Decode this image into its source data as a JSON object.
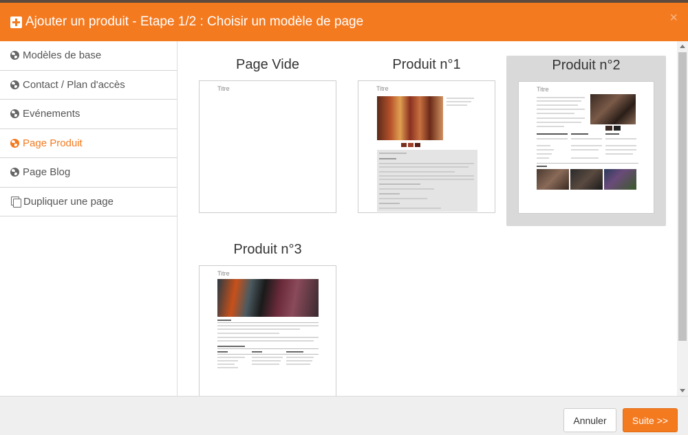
{
  "dialog": {
    "title": "Ajouter un produit - Etape 1/2 : Choisir un modèle de page",
    "close_glyph": "×",
    "accent_color": "#f47a20"
  },
  "sidebar": {
    "items": [
      {
        "label": "Modèles de base",
        "icon": "globe-icon",
        "active": false
      },
      {
        "label": "Contact / Plan d'accès",
        "icon": "globe-icon",
        "active": false
      },
      {
        "label": "Evénements",
        "icon": "globe-icon",
        "active": false
      },
      {
        "label": "Page Produit",
        "icon": "globe-icon",
        "active": true
      },
      {
        "label": "Page Blog",
        "icon": "globe-icon",
        "active": false
      },
      {
        "label": "Dupliquer une page",
        "icon": "copy-icon",
        "active": false
      }
    ]
  },
  "templates": [
    {
      "label": "Page Vide",
      "thumb_title": "Titre",
      "selected": false
    },
    {
      "label": "Produit n°1",
      "thumb_title": "Titre",
      "selected": false
    },
    {
      "label": "Produit n°2",
      "thumb_title": "Titre",
      "selected": true
    },
    {
      "label": "Produit n°3",
      "thumb_title": "Titre",
      "selected": false
    }
  ],
  "footer": {
    "cancel_label": "Annuler",
    "next_label": "Suite >>"
  }
}
